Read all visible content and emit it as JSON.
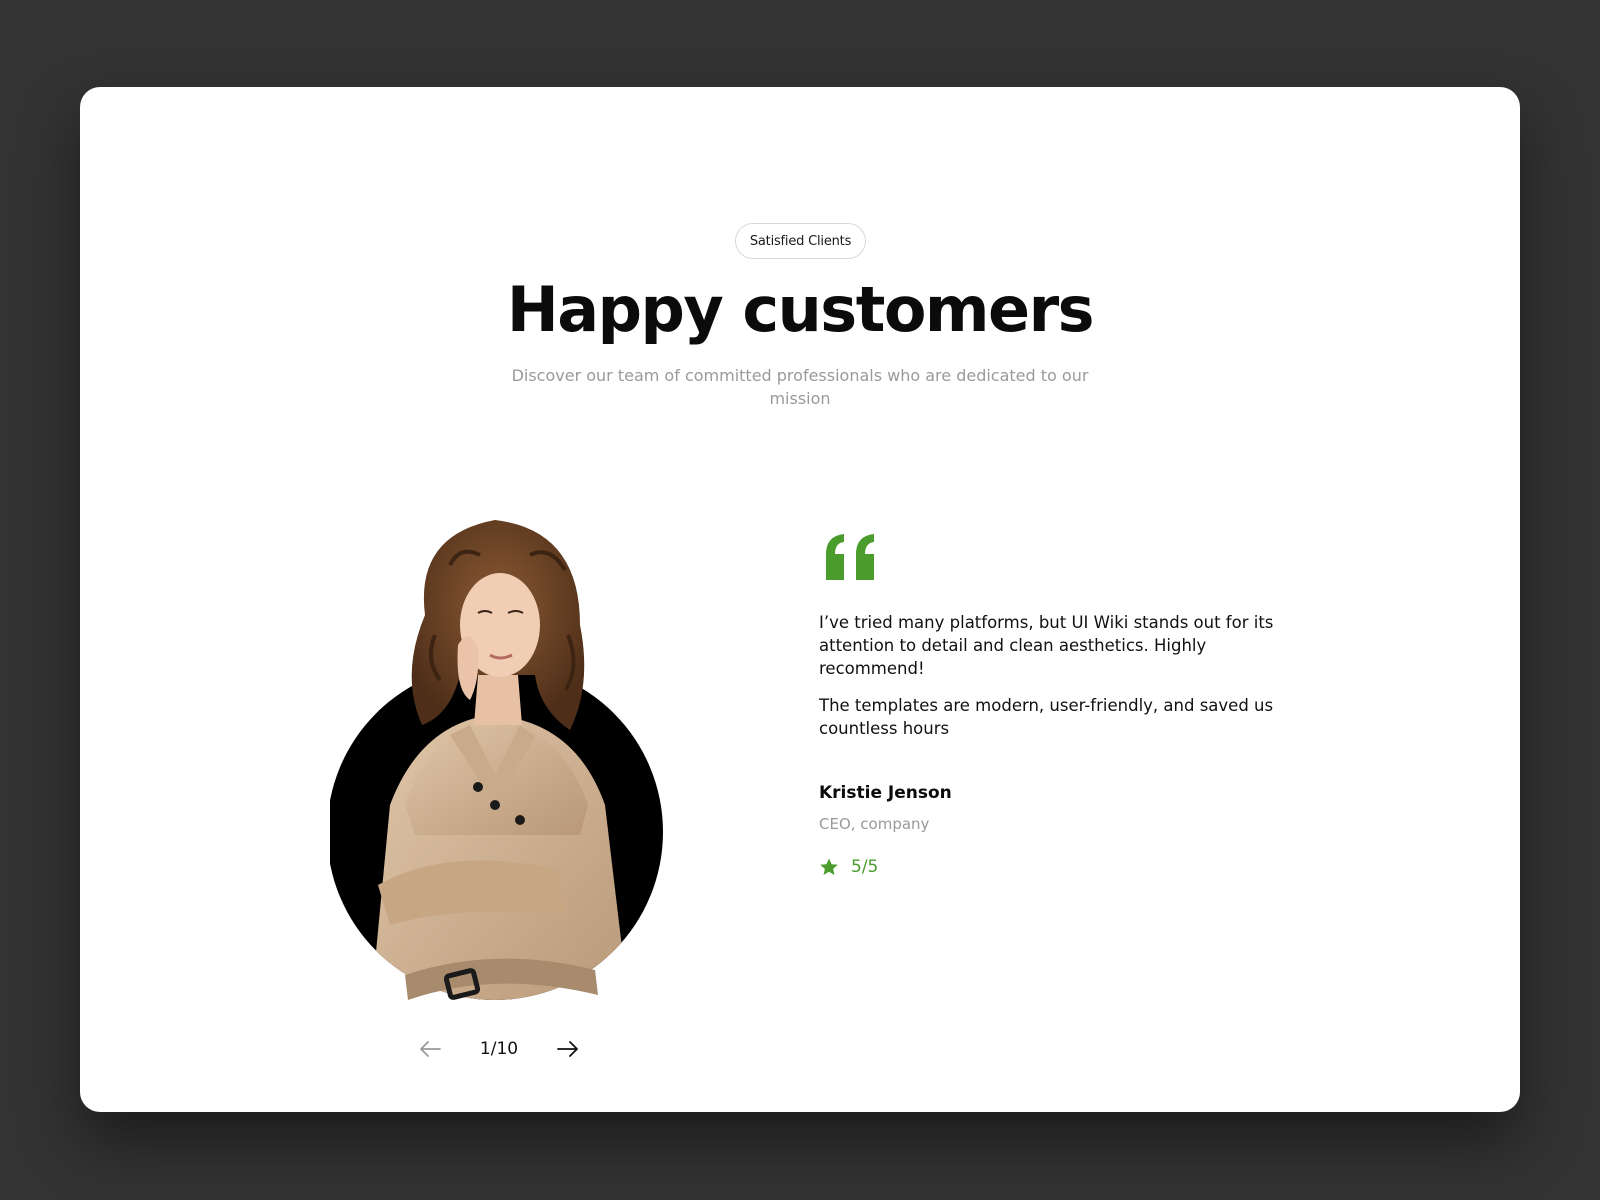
{
  "header": {
    "badge": "Satisfied Clients",
    "title": "Happy customers",
    "subtitle": "Discover our team of committed professionals who are dedicated to our mission"
  },
  "testimonial": {
    "paragraphs": [
      "I’ve tried many platforms, but UI Wiki stands out for its attention to detail and clean aesthetics. Highly recommend!",
      "The templates are modern, user-friendly, and saved us countless hours"
    ],
    "author": "Kristie Jenson",
    "role": "CEO, company",
    "rating": "5/5"
  },
  "pager": {
    "current": "1/10"
  },
  "colors": {
    "accent": "#4a9c2d",
    "background": "#333333",
    "card": "#ffffff"
  },
  "icons": {
    "quote": "quote-icon",
    "star": "star-icon",
    "prev": "arrow-left-icon",
    "next": "arrow-right-icon"
  }
}
